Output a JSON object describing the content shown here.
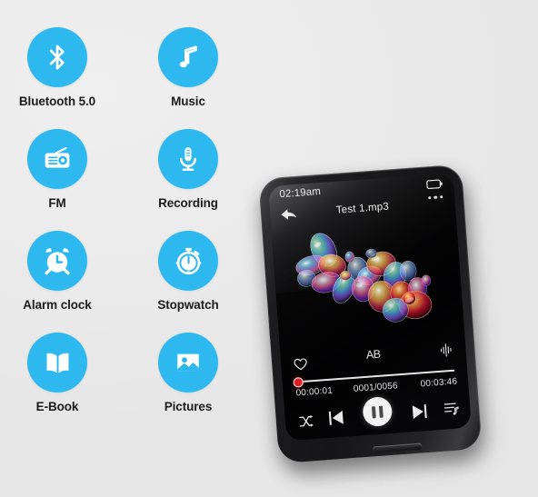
{
  "background": {
    "color": "#eaeaea"
  },
  "features": {
    "accent_color": "#2eb8f0",
    "label_color": "#1b1b1b",
    "items": [
      {
        "label": "Bluetooth 5.0",
        "icon": "bluetooth-icon",
        "col": 0,
        "row": 0
      },
      {
        "label": "Music",
        "icon": "music-note-icon",
        "col": 1,
        "row": 0
      },
      {
        "label": "FM",
        "icon": "radio-icon",
        "col": 0,
        "row": 1
      },
      {
        "label": "Recording",
        "icon": "microphone-icon",
        "col": 1,
        "row": 1
      },
      {
        "label": "Alarm clock",
        "icon": "alarm-clock-icon",
        "col": 0,
        "row": 2
      },
      {
        "label": "Stopwatch",
        "icon": "stopwatch-icon",
        "col": 1,
        "row": 2
      },
      {
        "label": "E-Book",
        "icon": "open-book-icon",
        "col": 0,
        "row": 3
      },
      {
        "label": "Pictures",
        "icon": "image-icon",
        "col": 1,
        "row": 3
      }
    ]
  },
  "device": {
    "name": "mp3-player",
    "body_color": "#1a1a1c",
    "screen": {
      "status_bar": {
        "time": "02:19am",
        "battery_icon": "battery-icon",
        "menu_icon": "more-options-icon"
      },
      "navigation": {
        "back_icon": "back-arrow-icon"
      },
      "track_title": "Test 1.mp3",
      "album_art": {
        "name": "soap-bubbles-artwork",
        "description": "iridescent soap bubble cluster"
      },
      "options": {
        "favorite_icon": "heart-icon",
        "ab_repeat_label": "AB",
        "equalizer_icon": "equalizer-icon"
      },
      "progress": {
        "elapsed": "00:00:01",
        "track_index": "0001/0056",
        "total": "00:03:46",
        "percent": 0.4,
        "knob_color": "#e02020",
        "track_color": "#e6e6e6"
      },
      "controls": {
        "shuffle_icon": "shuffle-icon",
        "previous_icon": "previous-track-icon",
        "play_pause_icon": "pause-icon",
        "next_icon": "next-track-icon",
        "playlist_icon": "playlist-icon"
      }
    }
  }
}
